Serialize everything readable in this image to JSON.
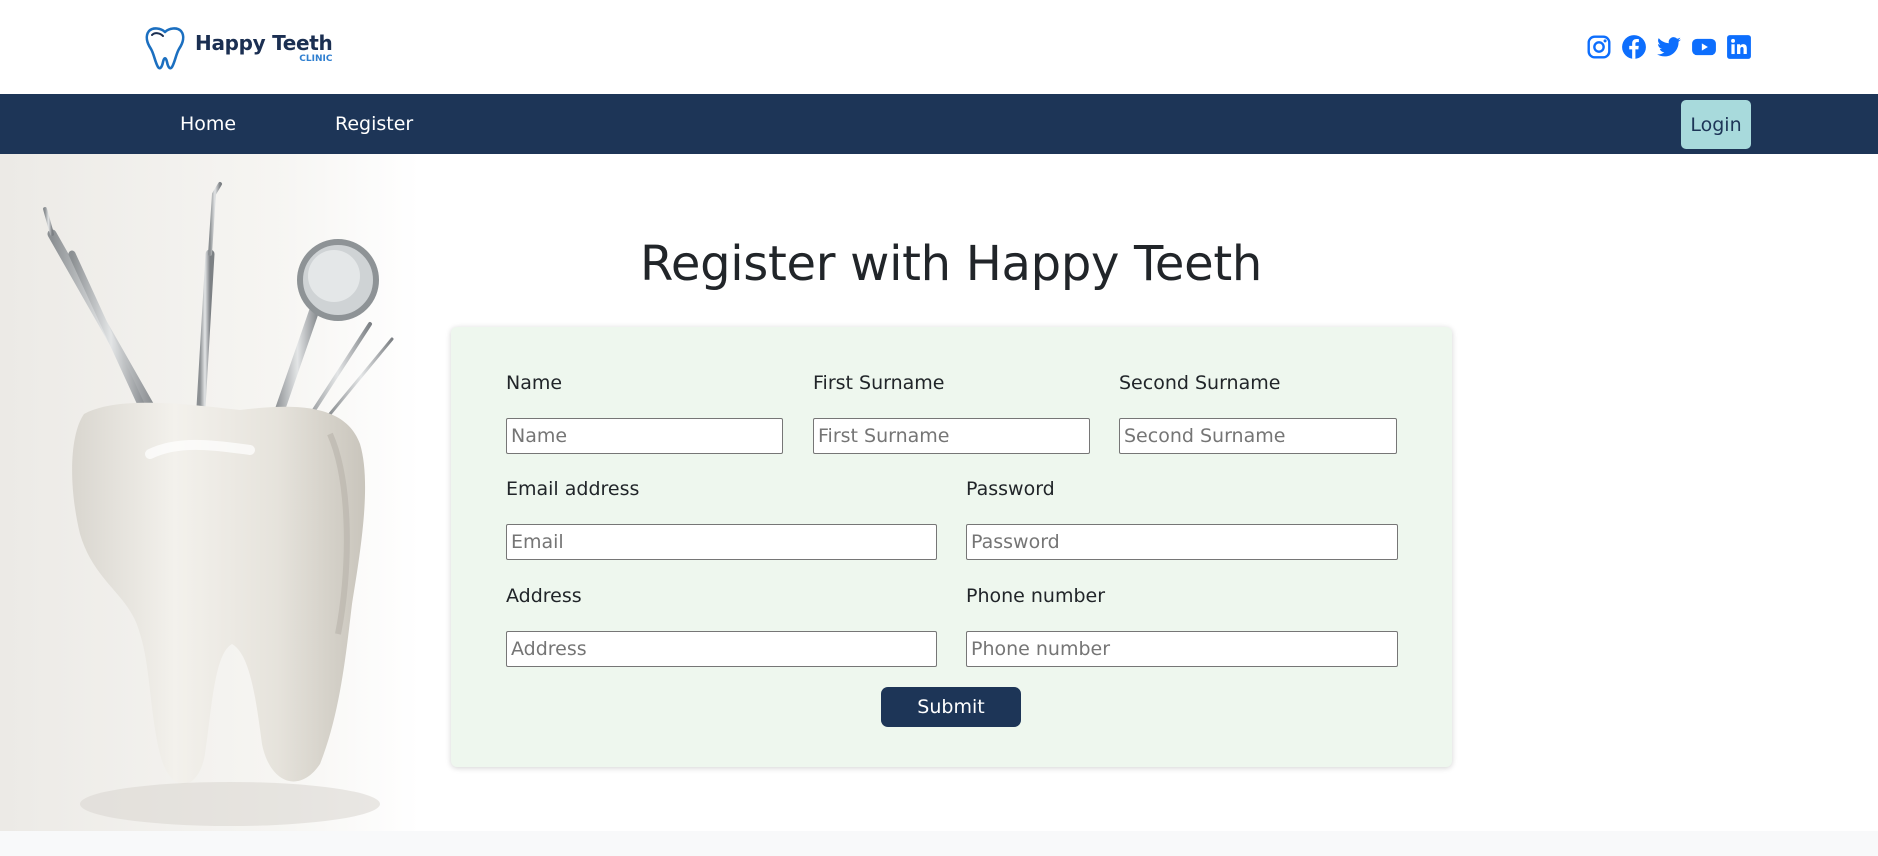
{
  "brand": {
    "name": "Happy Teeth",
    "sub": "CLINIC"
  },
  "colors": {
    "navbar": "#1d3557",
    "login_button": "#a8dadc",
    "social_icons": "#0d6efd",
    "form_bg": "#eef7ee"
  },
  "social_icons": [
    "instagram-icon",
    "facebook-icon",
    "twitter-icon",
    "youtube-icon",
    "linkedin-icon"
  ],
  "nav": {
    "home": "Home",
    "register": "Register",
    "login": "Login"
  },
  "main": {
    "title": "Register with Happy Teeth"
  },
  "form": {
    "name": {
      "label": "Name",
      "placeholder": "Name"
    },
    "first_surname": {
      "label": "First Surname",
      "placeholder": "First Surname"
    },
    "second_surname": {
      "label": "Second Surname",
      "placeholder": "Second Surname"
    },
    "email": {
      "label": "Email address",
      "placeholder": "Email"
    },
    "password": {
      "label": "Password",
      "placeholder": "Password"
    },
    "address": {
      "label": "Address",
      "placeholder": "Address"
    },
    "phone": {
      "label": "Phone number",
      "placeholder": "Phone number"
    },
    "submit": "Submit"
  }
}
